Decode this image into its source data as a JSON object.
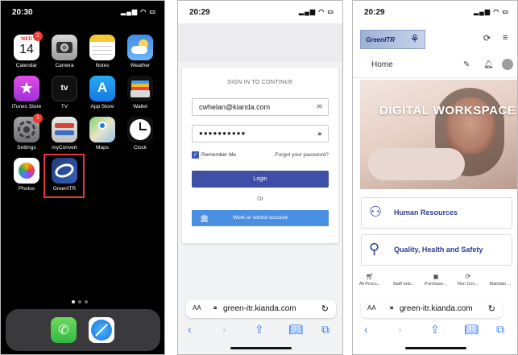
{
  "home_screen": {
    "time": "20:30",
    "status_icons": "▂▄▆ ◠ ▭",
    "apps": [
      {
        "label": "Calendar",
        "icon": "calendar-icon",
        "day": "WED",
        "date": "14",
        "badge": "2"
      },
      {
        "label": "Camera",
        "icon": "camera-icon"
      },
      {
        "label": "Notes",
        "icon": "notes-icon"
      },
      {
        "label": "Weather",
        "icon": "weather-icon"
      },
      {
        "label": "iTunes Store",
        "icon": "star-icon"
      },
      {
        "label": "TV",
        "icon": "tv-icon",
        "glyph": "tv"
      },
      {
        "label": "App Store",
        "icon": "app-store-icon"
      },
      {
        "label": "Wallet",
        "icon": "wallet-icon"
      },
      {
        "label": "Settings",
        "icon": "gear-icon",
        "badge": "1"
      },
      {
        "label": "myConvert",
        "icon": "convert-icon"
      },
      {
        "label": "Maps",
        "icon": "maps-icon"
      },
      {
        "label": "Clock",
        "icon": "clock-icon"
      },
      {
        "label": "Photos",
        "icon": "photos-icon"
      },
      {
        "label": "GreenITR",
        "icon": "greenitr-icon"
      }
    ],
    "dock": [
      "phone-icon",
      "safari-icon"
    ]
  },
  "signin_screen": {
    "time": "20:29",
    "heading": "SIGN IN TO CONTINUE",
    "email_value": "cwhelan@kianda.com",
    "password_value": "●●●●●●●●●●",
    "remember_label": "Remember Me",
    "forgot_link": "Forgot your password?",
    "login_button": "Login",
    "or_text": "Or",
    "work_button": "Work or school account",
    "url": "green-itr.kianda.com",
    "aa": "AA"
  },
  "app_screen": {
    "time": "20:29",
    "logo_text": "GreenITR",
    "nav_home": "Home",
    "hero_title": "DIGITAL WORKSPACE",
    "tiles": [
      {
        "label": "Human Resources",
        "icon": "people-icon"
      },
      {
        "label": "Quality, Health and Safety",
        "icon": "magnifier-icon"
      }
    ],
    "quick_tabs": [
      "All Procu...",
      "Staff onb...",
      "Purchase...",
      "Non Con...",
      "Maintain ..."
    ],
    "url": "green-itr.kianda.com",
    "aa": "AA"
  }
}
